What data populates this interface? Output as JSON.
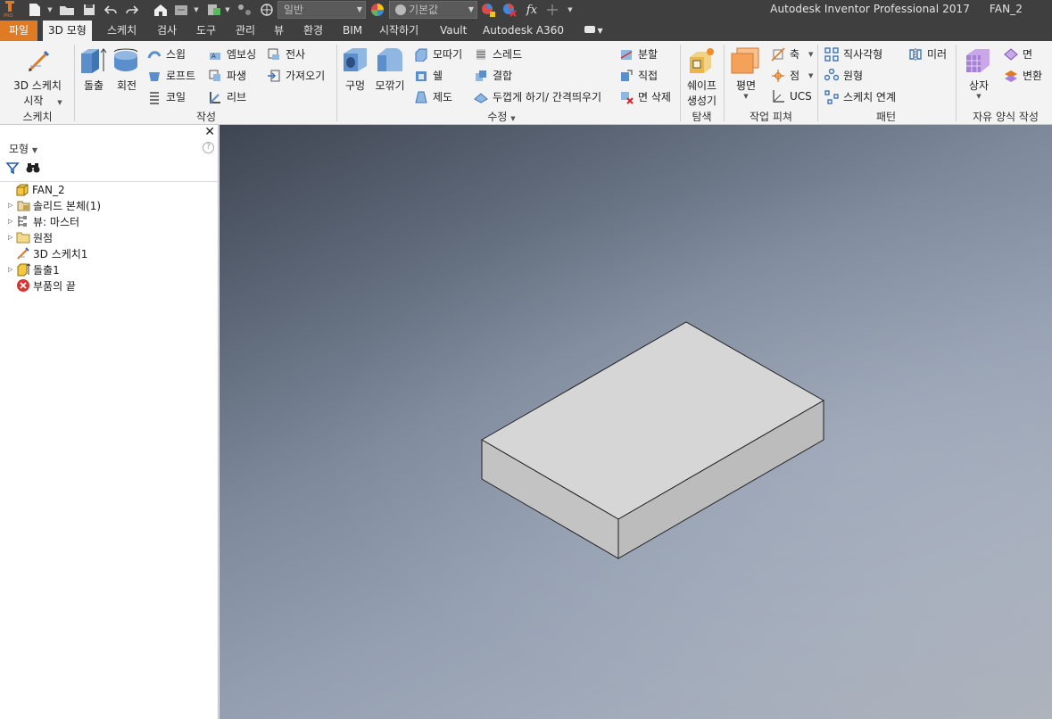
{
  "app": {
    "title": "Autodesk Inventor Professional 2017",
    "document": "FAN_2"
  },
  "quick_access": {
    "appearance_combo": "일반",
    "material_combo": "기본값",
    "fx_label": "fx"
  },
  "tabs": [
    {
      "label": "파일"
    },
    {
      "label": "3D 모형"
    },
    {
      "label": "스케치"
    },
    {
      "label": "검사"
    },
    {
      "label": "도구"
    },
    {
      "label": "관리"
    },
    {
      "label": "뷰"
    },
    {
      "label": "환경"
    },
    {
      "label": "BIM"
    },
    {
      "label": "시작하기"
    },
    {
      "label": "Vault"
    },
    {
      "label": "Autodesk A360"
    }
  ],
  "ribbon": {
    "sketch": {
      "group_label": "스케치",
      "sketch3d_line1": "3D 스케치",
      "sketch3d_line2": "시작"
    },
    "create": {
      "group_label": "작성",
      "extrude": "돌출",
      "revolve": "회전",
      "sweep": "스윕",
      "loft": "로프트",
      "coil": "코일",
      "emboss": "엠보싱",
      "derive": "파생",
      "rib": "리브",
      "decal": "전사",
      "import": "가져오기"
    },
    "modify": {
      "group_label": "수정",
      "hole": "구멍",
      "fillet": "모깎기",
      "chamfer": "모따기",
      "shell": "쉘",
      "draft": "제도",
      "thread": "스레드",
      "combine": "결합",
      "thicken": "두껍게 하기/ 간격띄우기",
      "split": "분할",
      "direct": "직접",
      "delete_face": "면 삭제"
    },
    "explore": {
      "group_label": "탐색",
      "shape_gen_line1": "쉐이프",
      "shape_gen_line2": "생성기"
    },
    "work_features": {
      "group_label": "작업 피쳐",
      "plane": "평면",
      "axis": "축",
      "point": "점",
      "ucs": "UCS"
    },
    "pattern": {
      "group_label": "패턴",
      "rectangular": "직사각형",
      "circular": "원형",
      "sketch_driven": "스케치 연계",
      "mirror": "미러"
    },
    "freeform": {
      "group_label": "자유 양식 작성",
      "box": "상자",
      "face": "면",
      "convert": "변환"
    }
  },
  "browser": {
    "header": "모형",
    "tree": [
      {
        "label": "FAN_2",
        "expandable": false,
        "icon": "part-icon"
      },
      {
        "label": "솔리드 본체(1)",
        "expandable": true,
        "icon": "solid-bodies-icon"
      },
      {
        "label": "뷰: 마스터",
        "expandable": true,
        "icon": "view-rep-icon"
      },
      {
        "label": "원점",
        "expandable": true,
        "icon": "origin-folder-icon"
      },
      {
        "label": "3D 스케치1",
        "expandable": false,
        "icon": "sketch3d-icon"
      },
      {
        "label": "돌출1",
        "expandable": true,
        "icon": "extrusion-icon"
      },
      {
        "label": "부품의 끝",
        "expandable": false,
        "icon": "end-of-part-icon"
      }
    ]
  },
  "colors": {
    "file_tab": "#e07b24",
    "titlebar": "#3f3f3f",
    "ribbon": "#f3f3f3",
    "box_top": "#d6d6d6",
    "box_front": "#c3c3c3",
    "box_side": "#bdbdbd"
  }
}
